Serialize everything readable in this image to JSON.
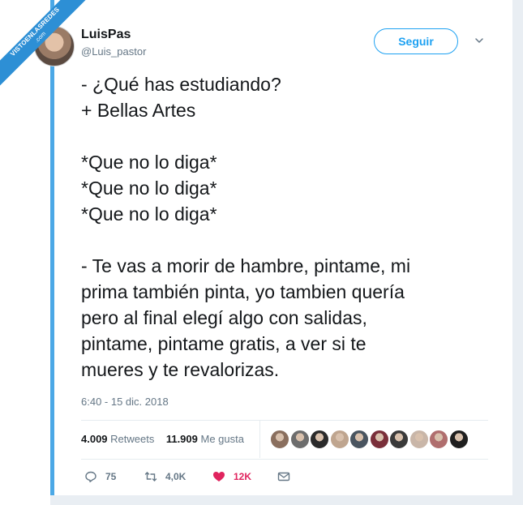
{
  "watermark": {
    "line1": "VISTOENLASREDES",
    "line2": ".com"
  },
  "author": {
    "name": "LuisPas",
    "handle": "@Luis_pastor"
  },
  "follow_label": "Seguir",
  "tweet_lines": [
    "- ¿Qué has estudiando?",
    "+ Bellas Artes",
    "",
    "*Que no lo diga*",
    "*Que no lo diga*",
    "*Que no lo diga*",
    "",
    "- Te vas a morir de hambre, pintame, mi",
    "prima también pinta, yo tambien quería",
    "pero al final elegí algo con salidas,",
    "pintame, pintame gratis, a ver si te",
    "mueres y te revalorizas."
  ],
  "timestamp": "6:40 - 15 dic. 2018",
  "stats": {
    "retweets_count": "4.009",
    "retweets_label": "Retweets",
    "likes_count": "11.909",
    "likes_label": "Me gusta"
  },
  "likers": [
    {
      "icon": "liker-avatar",
      "color": "#8a6f5e"
    },
    {
      "icon": "liker-avatar",
      "color": "#6d6d6d"
    },
    {
      "icon": "liker-avatar",
      "color": "#2b2b2b"
    },
    {
      "icon": "liker-avatar",
      "color": "#bfa58f"
    },
    {
      "icon": "liker-avatar",
      "color": "#4a5560"
    },
    {
      "icon": "liker-avatar",
      "color": "#7a2f3a"
    },
    {
      "icon": "liker-avatar",
      "color": "#3a3a3a"
    },
    {
      "icon": "liker-avatar",
      "color": "#c9b6a8"
    },
    {
      "icon": "liker-avatar",
      "color": "#b06e6e"
    },
    {
      "icon": "liker-avatar",
      "color": "#1f1f1f"
    }
  ],
  "actions": {
    "reply_count": "75",
    "retweet_count": "4,0K",
    "like_count": "12K"
  },
  "colors": {
    "accent": "#1da1f2",
    "like": "#e0245e",
    "muted": "#657786"
  }
}
